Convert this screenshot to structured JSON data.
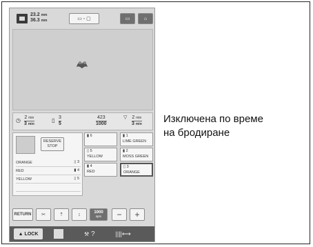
{
  "header": {
    "width_value": "23.2",
    "width_unit": "mm",
    "height_value": "36.3",
    "height_unit": "mm"
  },
  "stitch_bar": {
    "time_total": "2",
    "time_total_unit": "min",
    "time_remaining": "3",
    "time_remaining_unit": "min",
    "colors_done": "3",
    "colors_total": "5",
    "stitches_done": "423",
    "stitches_total": "1000",
    "stop_time": "2",
    "stop_time_unit": "min",
    "stop_time2": "3",
    "stop_time2_unit": "min"
  },
  "left_panel": {
    "reserve_stop_label": "RESERVE STOP",
    "colors": [
      {
        "name": "ORANGE",
        "num": "3"
      },
      {
        "name": "RED",
        "num": "4"
      },
      {
        "name": "YELLOW",
        "num": "5"
      }
    ]
  },
  "spools": [
    {
      "num": "6",
      "name": ""
    },
    {
      "num": "1",
      "name": "LIME GREEN"
    },
    {
      "num": "5",
      "name": "YELLOW"
    },
    {
      "num": "2",
      "name": "MOSS GREEN"
    },
    {
      "num": "4",
      "name": "RED"
    },
    {
      "num": "3",
      "name": "ORANGE"
    }
  ],
  "bottom": {
    "return_label": "RETURN",
    "speed_value": "1000",
    "speed_unit": "spm",
    "minus": "−",
    "plus": "+"
  },
  "statusbar": {
    "lock_label": "LOCK",
    "help": "?"
  },
  "caption": {
    "line1": "Изключена по време",
    "line2": "на бродиране"
  }
}
